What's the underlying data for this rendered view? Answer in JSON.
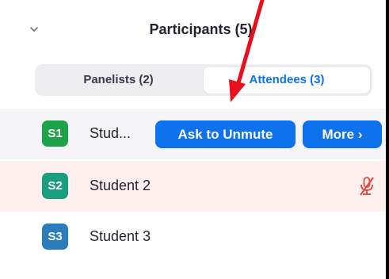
{
  "panel": {
    "title": "Participants (5)"
  },
  "tabs": [
    {
      "label": "Panelists (2)",
      "selected": false
    },
    {
      "label": "Attendees (3)",
      "selected": true
    }
  ],
  "attendees": [
    {
      "initials": "S1",
      "name": "Stud...",
      "avatar_color": "#1fa34a",
      "highlighted": true,
      "ask_to_unmute_label": "Ask to Unmute",
      "more_label": "More ›"
    },
    {
      "initials": "S2",
      "name": "Student 2",
      "avatar_color": "#1b9e7e",
      "muted": true
    },
    {
      "initials": "S3",
      "name": "Student 3",
      "avatar_color": "#2a7db8"
    }
  ],
  "colors": {
    "accent": "#0e72ed",
    "annotation_arrow": "#e8101a",
    "muted_icon": "#e0453a"
  },
  "icons": {
    "collapse": "chevron-down-icon",
    "muted": "microphone-muted-icon"
  }
}
